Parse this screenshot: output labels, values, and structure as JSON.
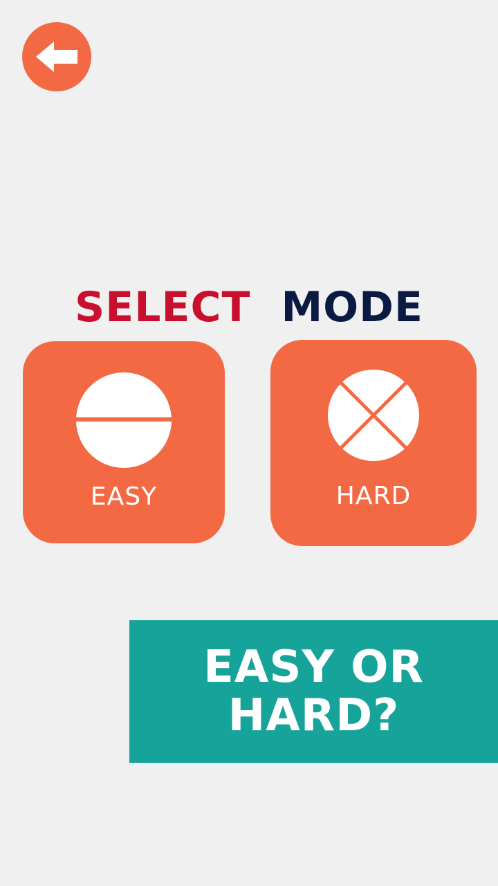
{
  "back_button": {
    "icon": "arrow-left-icon"
  },
  "title": {
    "word1": "SELECT",
    "word2": "MODE"
  },
  "modes": {
    "easy": {
      "label": "EASY",
      "icon": "half-circle-icon"
    },
    "hard": {
      "label": "HARD",
      "icon": "crossed-circle-icon"
    }
  },
  "banner": {
    "text": "EASY OR HARD?"
  },
  "colors": {
    "background": "#f0f0f0",
    "accent": "#f26944",
    "select_word": "#c8102e",
    "mode_word": "#0b1a43",
    "banner": "#15a39a"
  }
}
